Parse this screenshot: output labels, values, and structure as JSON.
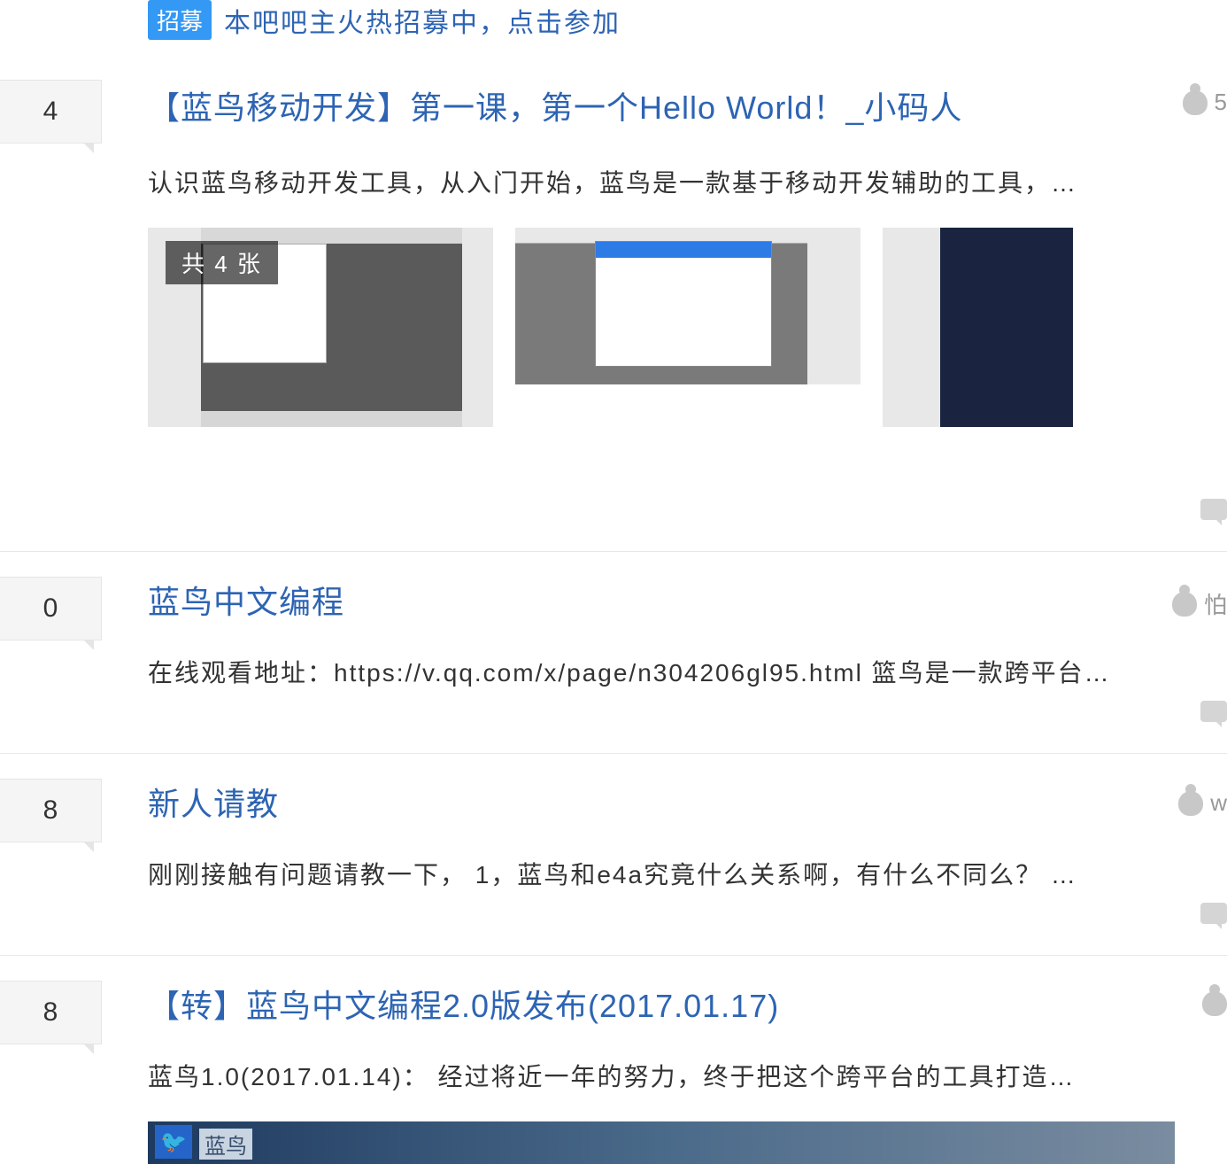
{
  "announce": {
    "badge": "招募",
    "text": "本吧吧主火热招募中，点击参加"
  },
  "threads": [
    {
      "reply_count": "4",
      "title": "【蓝鸟移动开发】第一课，第一个Hello World！_小码人",
      "excerpt": "认识蓝鸟移动开发工具，从入门开始，蓝鸟是一款基于移动开发辅助的工具，…",
      "image_overlay": "共 4 张",
      "user_hint": "5"
    },
    {
      "reply_count": "0",
      "title": "蓝鸟中文编程",
      "excerpt": "在线观看地址：https://v.qq.com/x/page/n304206gl95.html 篮鸟是一款跨平台…",
      "user_hint": "怕"
    },
    {
      "reply_count": "8",
      "title": "新人请教",
      "excerpt": "刚刚接触有问题请教一下， 1，蓝鸟和e4a究竟什么关系啊，有什么不同么？ …",
      "user_hint": "w"
    },
    {
      "reply_count": "8",
      "title": "【转】蓝鸟中文编程2.0版发布(2017.01.17)",
      "excerpt": "蓝鸟1.0(2017.01.14)： 经过将近一年的努力，终于把这个跨平台的工具打造…",
      "app_label": "蓝鸟"
    }
  ]
}
